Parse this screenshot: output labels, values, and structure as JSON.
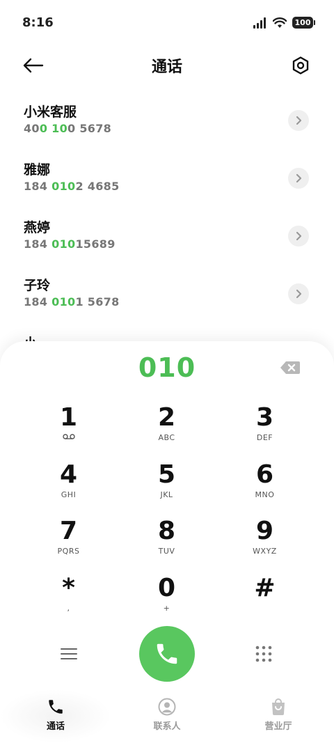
{
  "status_bar": {
    "time": "8:16",
    "battery": "100"
  },
  "header": {
    "title": "通话"
  },
  "results": [
    {
      "name": "小米客服",
      "number_pre": "40",
      "number_hl": "0 10",
      "number_post": "0 5678"
    },
    {
      "name": "雅娜",
      "number_pre": "184 ",
      "number_hl": "010",
      "number_post": "2 4685"
    },
    {
      "name": "燕婷",
      "number_pre": "184 ",
      "number_hl": "010",
      "number_post": "15689"
    },
    {
      "name": "子玲",
      "number_pre": "184 ",
      "number_hl": "010",
      "number_post": "1 5678"
    }
  ],
  "partial_result": "小",
  "dialpad": {
    "input": "010",
    "keys": [
      {
        "digit": "1",
        "letters": ""
      },
      {
        "digit": "2",
        "letters": "ABC"
      },
      {
        "digit": "3",
        "letters": "DEF"
      },
      {
        "digit": "4",
        "letters": "GHI"
      },
      {
        "digit": "5",
        "letters": "JKL"
      },
      {
        "digit": "6",
        "letters": "MNO"
      },
      {
        "digit": "7",
        "letters": "PQRS"
      },
      {
        "digit": "8",
        "letters": "TUV"
      },
      {
        "digit": "9",
        "letters": "WXYZ"
      },
      {
        "digit": "*",
        "letters": ","
      },
      {
        "digit": "0",
        "letters": "+"
      },
      {
        "digit": "#",
        "letters": ""
      }
    ]
  },
  "tabs": [
    {
      "label": "通话",
      "icon": "phone-icon",
      "active": true
    },
    {
      "label": "联系人",
      "icon": "contact-icon",
      "active": false
    },
    {
      "label": "营业厅",
      "icon": "bag-icon",
      "active": false
    }
  ],
  "colors": {
    "accent": "#4cbd55",
    "call_button": "#59c75f"
  }
}
